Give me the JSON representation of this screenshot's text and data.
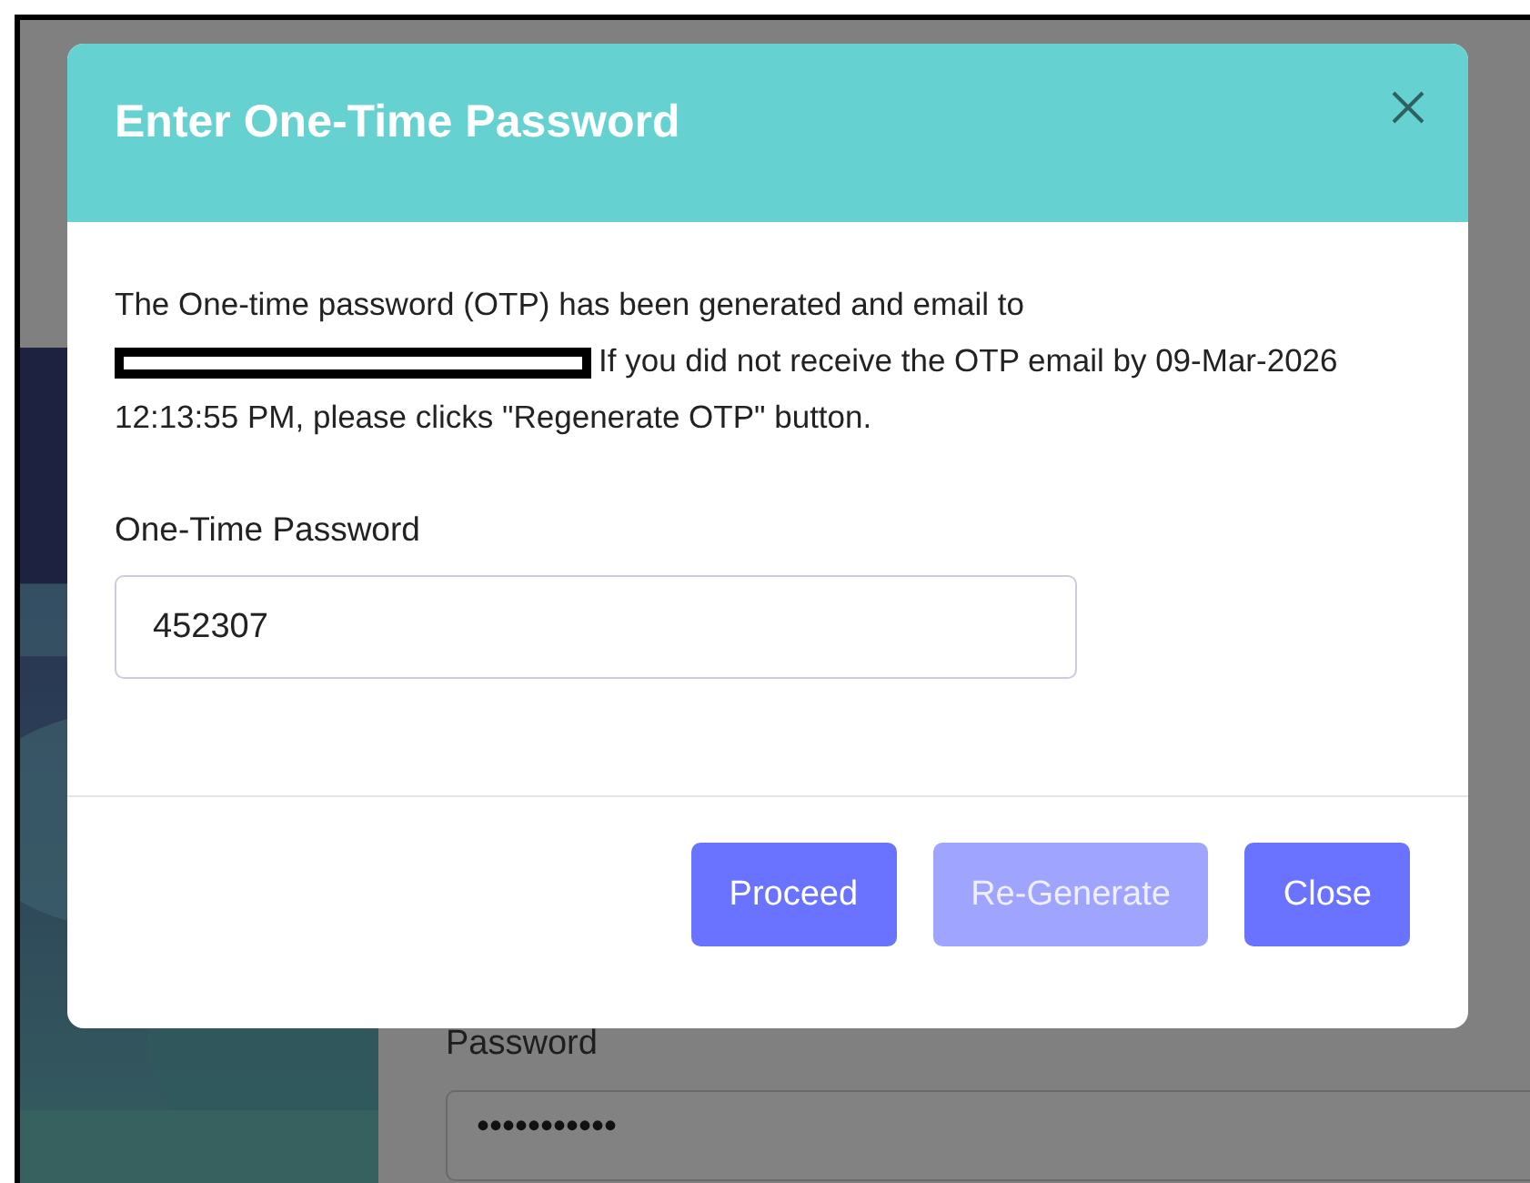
{
  "background": {
    "kind": "picture",
    "password_label": "Password",
    "password_value": "•••••••••••"
  },
  "dialog": {
    "title": "Enter One-Time Password",
    "message": {
      "text_before": "The One-time password (OTP) has been generated and email to",
      "redacted": true,
      "text_after": "If you did not receive the OTP email by 09-Mar-2026 12:13:55 PM, please clicks \"Regenerate OTP\" button."
    },
    "field": {
      "label": "One-Time Password",
      "value": "452307"
    },
    "buttons": [
      {
        "label": "Proceed",
        "disabled": false
      },
      {
        "label": "Re-Generate",
        "disabled": true
      },
      {
        "label": "Close",
        "disabled": false
      }
    ]
  }
}
